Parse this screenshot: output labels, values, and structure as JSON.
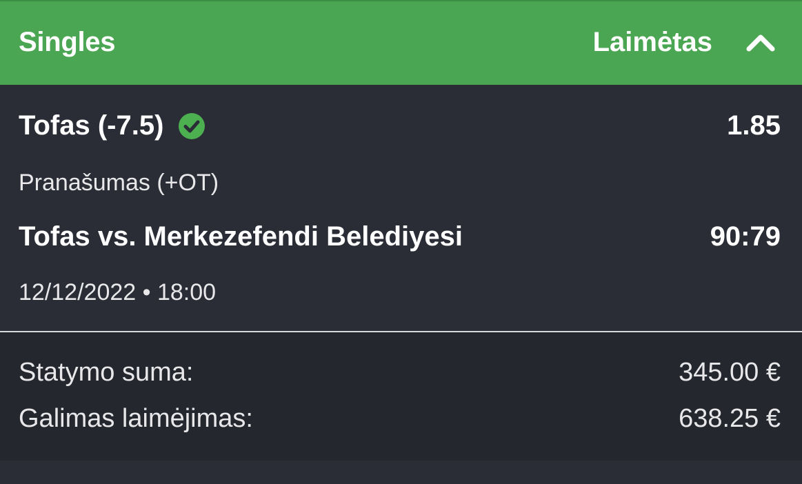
{
  "header": {
    "title": "Singles",
    "status": "Laimėtas",
    "collapse_icon": "chevron-up-icon"
  },
  "selection": {
    "name": "Tofas (-7.5)",
    "status_icon": "check-circle-icon",
    "odds": "1.85",
    "market": "Pranašumas (+OT)",
    "event": "Tofas vs. Merkezefendi Belediyesi",
    "score": "90:79",
    "datetime": "12/12/2022 • 18:00"
  },
  "summary": {
    "stake_label": "Statymo suma:",
    "stake_value": "345.00 €",
    "payout_label": "Galimas laimėjimas:",
    "payout_value": "638.25 €"
  },
  "colors": {
    "header_bg": "#4aa652",
    "card_bg": "#2b2d36",
    "check_green": "#4caf50",
    "text": "#ffffff"
  }
}
